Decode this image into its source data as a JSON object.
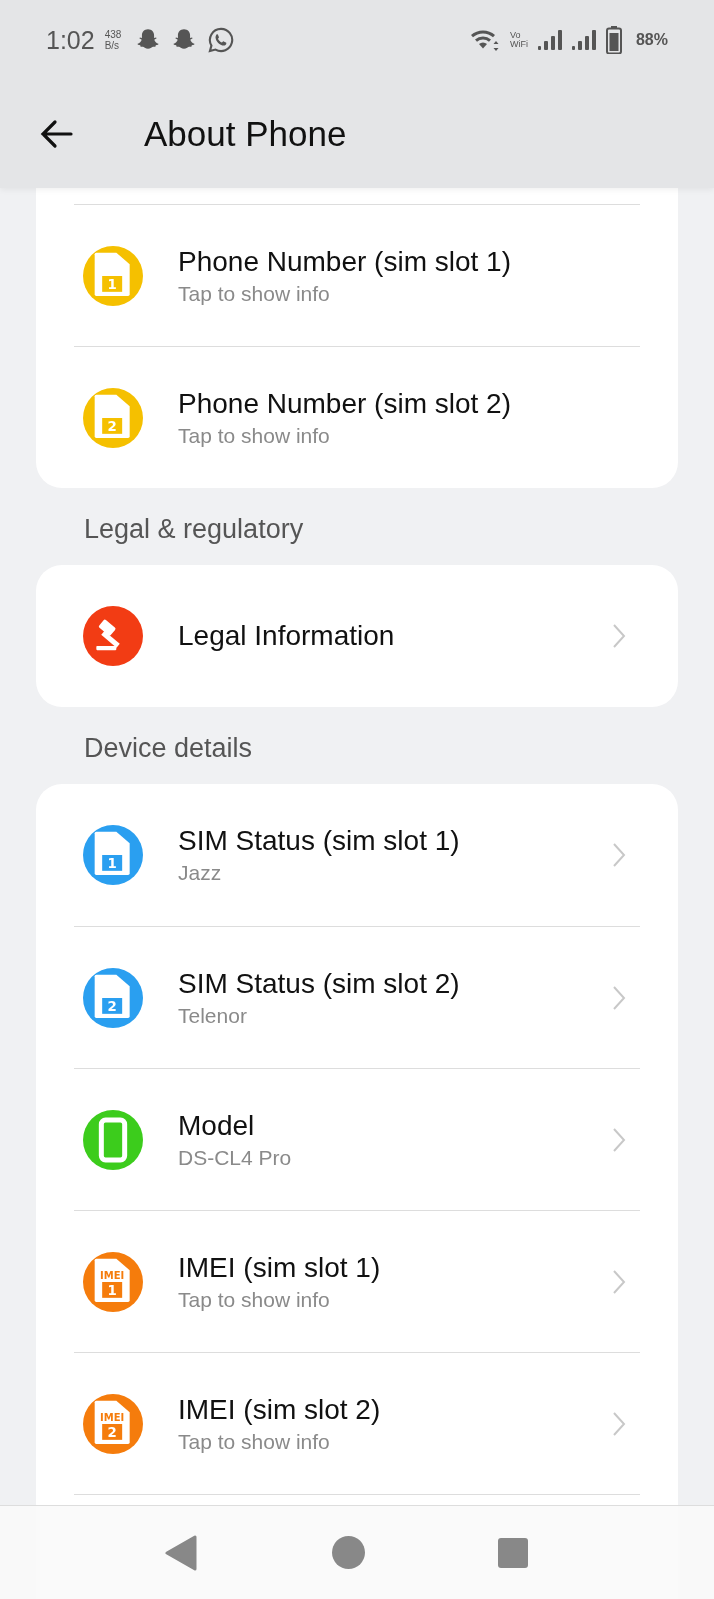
{
  "status_bar": {
    "time": "1:02",
    "speed_value": "438",
    "speed_unit": "B/s",
    "vo_top": "Vo",
    "vo_bottom": "WiFi",
    "battery": "88%"
  },
  "app_bar": {
    "title": "About Phone"
  },
  "sections": [
    {
      "items": [
        {
          "title": "Phone Number (sim slot 1)",
          "subtitle": "Tap to show info",
          "kind": "sim",
          "badge": "1",
          "color": "#f5c000",
          "chevron": false
        },
        {
          "title": "Phone Number (sim slot 2)",
          "subtitle": "Tap to show info",
          "kind": "sim",
          "badge": "2",
          "color": "#f5c000",
          "chevron": false
        }
      ]
    },
    {
      "header": "Legal & regulatory",
      "items": [
        {
          "title": "Legal Information",
          "kind": "gavel",
          "color": "#f23c14",
          "chevron": true
        }
      ]
    },
    {
      "header": "Device details",
      "items": [
        {
          "title": "SIM Status (sim slot 1)",
          "subtitle": "Jazz",
          "kind": "sim",
          "badge": "1",
          "color": "#2a9ff0",
          "chevron": true
        },
        {
          "title": "SIM Status (sim slot 2)",
          "subtitle": "Telenor",
          "kind": "sim",
          "badge": "2",
          "color": "#2a9ff0",
          "chevron": true
        },
        {
          "title": "Model",
          "subtitle": "DS-CL4 Pro",
          "kind": "phone",
          "color": "#3ccc1c",
          "chevron": true
        },
        {
          "title": "IMEI (sim slot 1)",
          "subtitle": "Tap to show info",
          "kind": "sim",
          "badge_label": "IMEI",
          "badge": "1",
          "color": "#f57c0c",
          "chevron": true
        },
        {
          "title": "IMEI (sim slot 2)",
          "subtitle": "Tap to show info",
          "kind": "sim",
          "badge_label": "IMEI",
          "badge": "2",
          "color": "#f57c0c",
          "chevron": true
        }
      ]
    }
  ]
}
